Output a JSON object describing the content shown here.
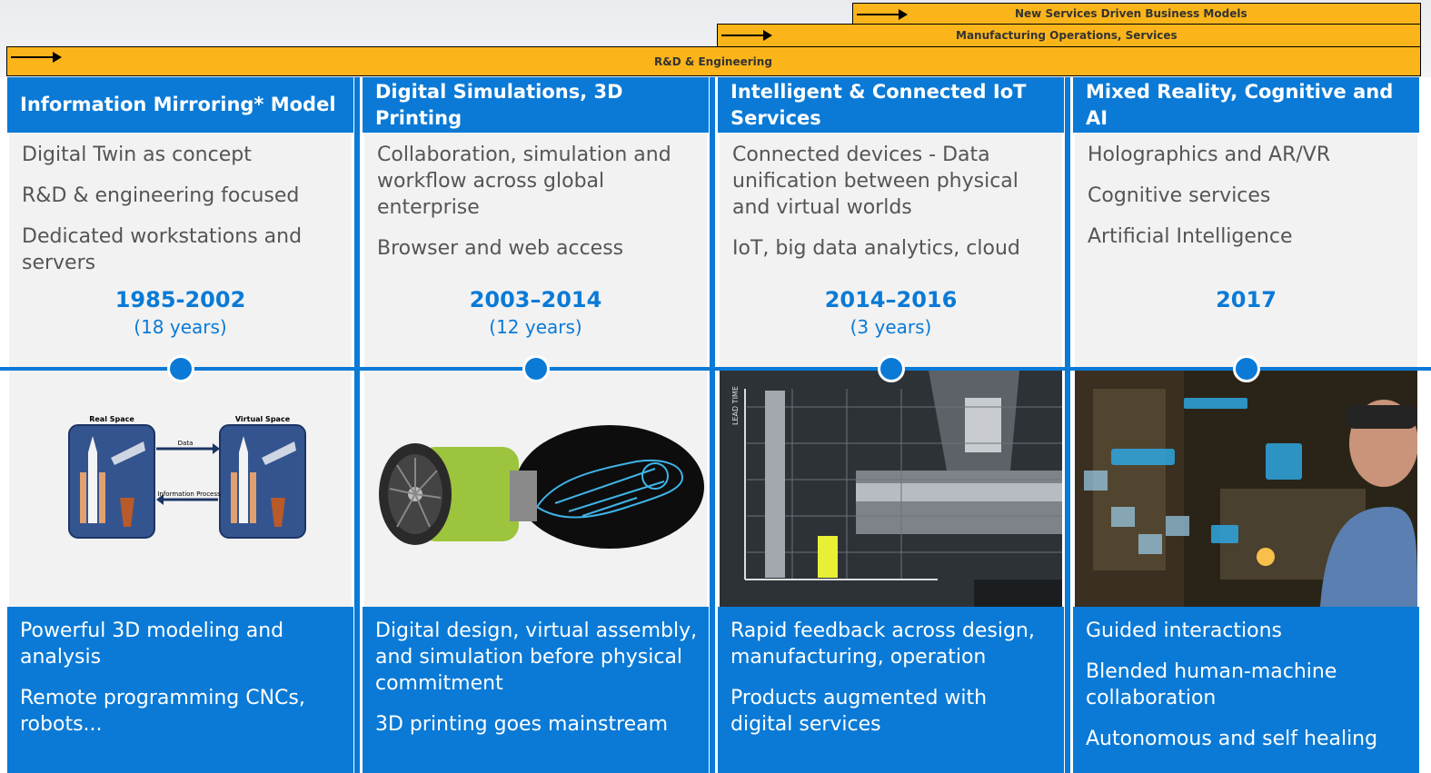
{
  "phases_bars": [
    {
      "label": "New  Services  Driven  Business    Models"
    },
    {
      "label": "Manufacturing  Operations,  Services"
    },
    {
      "label": "R&D & Engineering"
    }
  ],
  "columns": [
    {
      "title": "Information Mirroring* Model",
      "points": [
        "Digital Twin as concept",
        "R&D & engineering focused",
        "Dedicated workstations and servers"
      ],
      "years": "1985-2002",
      "duration": "(18 years)",
      "figure_labels": {
        "left": "Real Space",
        "right": "Virtual Space",
        "data": "Data",
        "info": "Information Process"
      },
      "footer": [
        "Powerful 3D modeling and analysis",
        "Remote programming CNCs, robots..."
      ]
    },
    {
      "title": "Digital Simulations, 3D Printing",
      "points": [
        "Collaboration, simulation and workflow across global enterprise",
        "Browser and web access"
      ],
      "years": "2003–2014",
      "duration": "(12 years)",
      "footer": [
        "Digital design, virtual assembly, and simulation before physical commitment",
        "3D printing goes mainstream"
      ]
    },
    {
      "title": "Intelligent & Connected IoT Services",
      "points": [
        "Connected devices - Data unification between physical and virtual worlds",
        "IoT, big data analytics, cloud"
      ],
      "years": "2014–2016",
      "duration": "(3 years)",
      "figure_labels": {
        "axis": "LEAD TIME"
      },
      "footer": [
        "Rapid feedback across design, manufacturing, operation",
        "Products augmented with digital services"
      ]
    },
    {
      "title": "Mixed Reality, Cognitive and AI",
      "points": [
        "Holographics and AR/VR",
        "Cognitive services",
        "Artificial Intelligence"
      ],
      "years": "2017",
      "duration": "",
      "footer": [
        "Guided interactions",
        "Blended human-machine collaboration",
        "Autonomous and self healing"
      ]
    }
  ],
  "colors": {
    "accent": "#0a7ad6",
    "bar": "#fbb51a",
    "panel": "#f2f2f2"
  },
  "icons": [
    "arrow-right-icon",
    "rocket-icon",
    "jet-engine-icon",
    "cnc-machine-photo",
    "hololens-photo"
  ]
}
